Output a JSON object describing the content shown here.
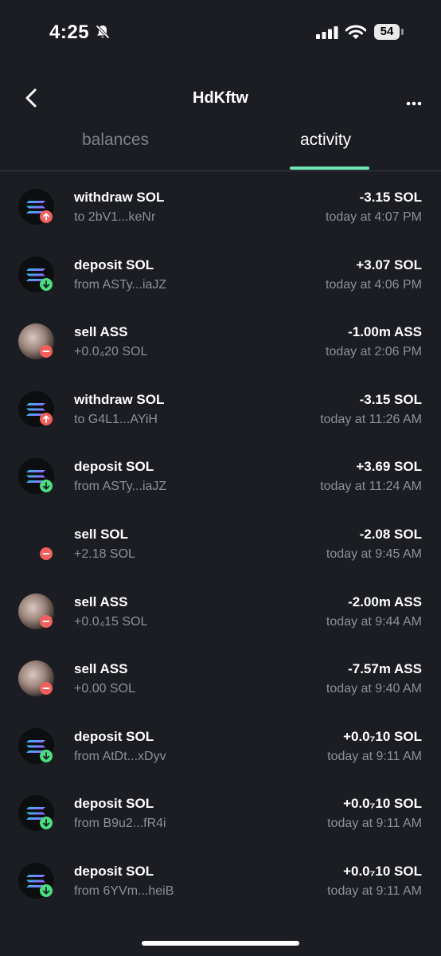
{
  "status": {
    "time": "4:25",
    "battery": "54"
  },
  "header": {
    "title": "HdKftw"
  },
  "tabs": [
    {
      "label": "balances"
    },
    {
      "label": "activity"
    }
  ],
  "activity": [
    {
      "icon": "sol",
      "dir": "up",
      "title": "withdraw SOL",
      "sub": "to 2bV1...keNr",
      "amount": "-3.15 SOL",
      "time": "today at 4:07 PM"
    },
    {
      "icon": "sol",
      "dir": "down",
      "title": "deposit SOL",
      "sub": "from ASTy...iaJZ",
      "amount": "+3.07 SOL",
      "time": "today at 4:06 PM"
    },
    {
      "icon": "ass",
      "dir": "minus",
      "title": "sell ASS",
      "sub": "+0.0₄20 SOL",
      "amount": "-1.00m ASS",
      "time": "today at 2:06 PM"
    },
    {
      "icon": "sol",
      "dir": "up",
      "title": "withdraw SOL",
      "sub": "to G4L1...AYiH",
      "amount": "-3.15 SOL",
      "time": "today at 11:26 AM"
    },
    {
      "icon": "sol",
      "dir": "down",
      "title": "deposit SOL",
      "sub": "from ASTy...iaJZ",
      "amount": "+3.69 SOL",
      "time": "today at 11:24 AM"
    },
    {
      "icon": "none",
      "dir": "minus",
      "title": "sell SOL",
      "sub": "+2.18 SOL",
      "amount": "-2.08 SOL",
      "time": "today at 9:45 AM"
    },
    {
      "icon": "ass",
      "dir": "minus",
      "title": "sell ASS",
      "sub": "+0.0₄15 SOL",
      "amount": "-2.00m ASS",
      "time": "today at 9:44 AM"
    },
    {
      "icon": "ass",
      "dir": "minus",
      "title": "sell ASS",
      "sub": "+0.00 SOL",
      "amount": "-7.57m ASS",
      "time": "today at 9:40 AM"
    },
    {
      "icon": "sol",
      "dir": "down",
      "title": "deposit SOL",
      "sub": "from AtDt...xDyv",
      "amount": "+0.0₇10 SOL",
      "time": "today at 9:11 AM"
    },
    {
      "icon": "sol",
      "dir": "down",
      "title": "deposit SOL",
      "sub": "from B9u2...fR4i",
      "amount": "+0.0₇10 SOL",
      "time": "today at 9:11 AM"
    },
    {
      "icon": "sol",
      "dir": "down",
      "title": "deposit SOL",
      "sub": "from 6YVm...heiB",
      "amount": "+0.0₇10 SOL",
      "time": "today at 9:11 AM"
    }
  ],
  "colors": {
    "accent": "#6ee7b7",
    "negative": "#f25f5c",
    "positive": "#4ade80",
    "background": "#1b1d22"
  }
}
